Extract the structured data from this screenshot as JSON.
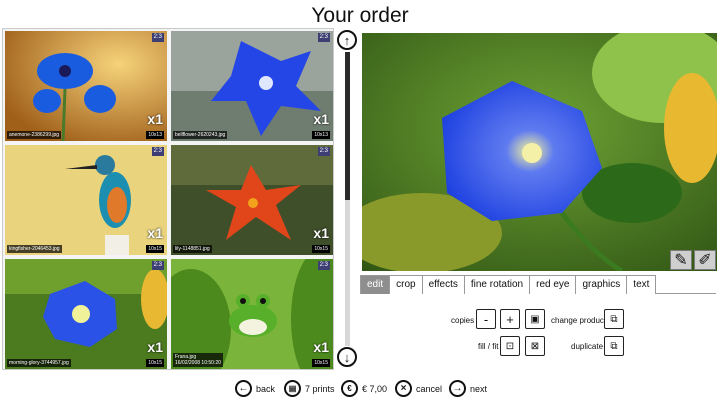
{
  "page_title": "Your order",
  "thumbnails": [
    {
      "filename": "anemone-2386299.jpg",
      "ratio": "2:3",
      "qty": "x1",
      "size": "10x13"
    },
    {
      "filename": "bellflower-2620243.jpg",
      "ratio": "2:3",
      "qty": "x1",
      "size": "10x13"
    },
    {
      "filename": "kingfisher-2046453.jpg",
      "ratio": "2:3",
      "qty": "x1",
      "size": "10x15"
    },
    {
      "filename": "lily-1148851.jpg",
      "ratio": "2:3",
      "qty": "x1",
      "size": "10x15"
    },
    {
      "filename": "morning-glory-3744957.jpg",
      "ratio": "2:3",
      "qty": "x1",
      "size": "10x15",
      "selected": true
    },
    {
      "filename": "Frana.jpg\n16/02/2008 10:50:20",
      "ratio": "2:3",
      "qty": "x1",
      "size": "10x15"
    }
  ],
  "preview": {
    "icons": [
      "adjust-icon",
      "red-eye-tool-icon"
    ]
  },
  "tabs": [
    {
      "label": "edit",
      "active": true
    },
    {
      "label": "crop"
    },
    {
      "label": "effects"
    },
    {
      "label": "fine rotation"
    },
    {
      "label": "red eye"
    },
    {
      "label": "graphics"
    },
    {
      "label": "text"
    }
  ],
  "controls": {
    "copies_label": "copies",
    "minus": "-",
    "plus": "+",
    "change_product_label": "change product",
    "fill_fit_label": "fill / fit",
    "duplicate_label": "duplicate"
  },
  "nav": {
    "back": "back",
    "prints": "7 prints",
    "price": "€ 7,00",
    "cancel": "cancel",
    "next": "next"
  },
  "colors": {
    "accent_selected": "#f0b030",
    "badge": "#3d3f74",
    "active_tab": "#8e8e8e"
  }
}
